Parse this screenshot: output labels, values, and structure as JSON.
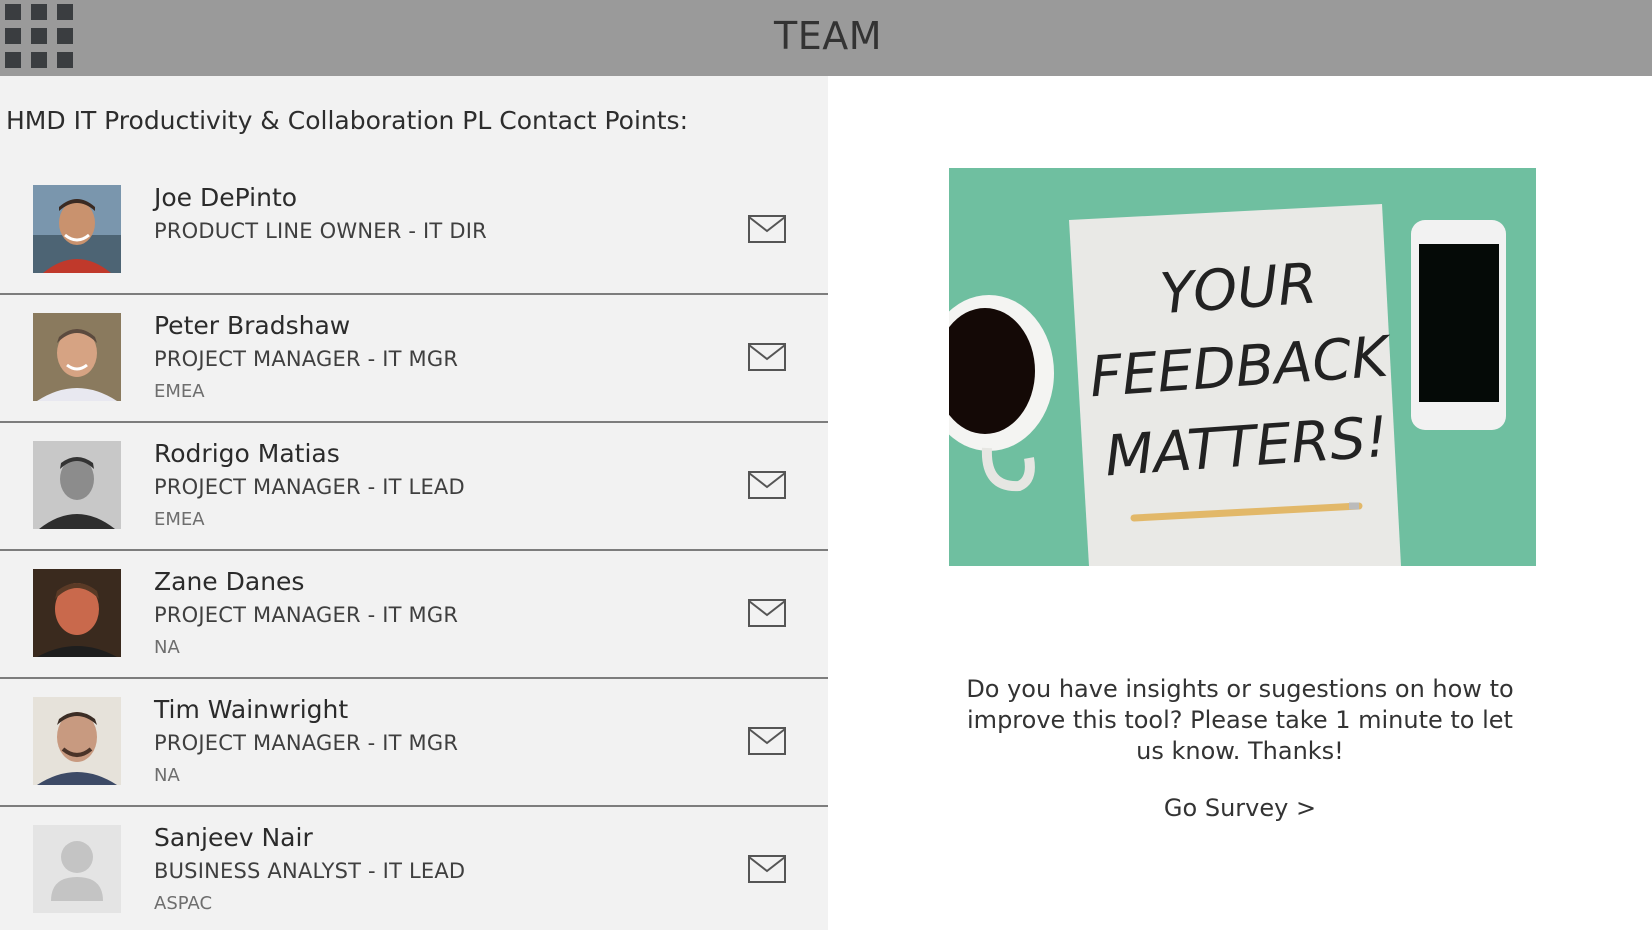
{
  "header": {
    "title": "TEAM",
    "menu_icon": "app-grid-icon"
  },
  "section_title": "HMD IT Productivity & Collaboration PL Contact Points:",
  "contacts": [
    {
      "name": "Joe DePinto",
      "role": "PRODUCT LINE OWNER - IT DIR",
      "region": ""
    },
    {
      "name": "Peter Bradshaw",
      "role": "PROJECT MANAGER - IT MGR",
      "region": "EMEA"
    },
    {
      "name": "Rodrigo Matias",
      "role": "PROJECT MANAGER - IT LEAD",
      "region": "EMEA"
    },
    {
      "name": "Zane Danes",
      "role": "PROJECT MANAGER - IT MGR",
      "region": "NA"
    },
    {
      "name": "Tim Wainwright",
      "role": "PROJECT MANAGER - IT MGR",
      "region": "NA"
    },
    {
      "name": "Sanjeev Nair",
      "role": "BUSINESS ANALYST - IT LEAD",
      "region": "ASPAC"
    }
  ],
  "feedback": {
    "image_text": [
      "YOUR",
      "FEEDBACK",
      "MATTERS!"
    ],
    "text": "Do you have insights or sugestions on how to improve this tool? Please take 1 minute to let us know. Thanks!",
    "link": "Go Survey >"
  },
  "colors": {
    "header_bg": "#9a9a9a",
    "panel_bg": "#f2f2f2",
    "image_bg": "#6fbfa0"
  }
}
